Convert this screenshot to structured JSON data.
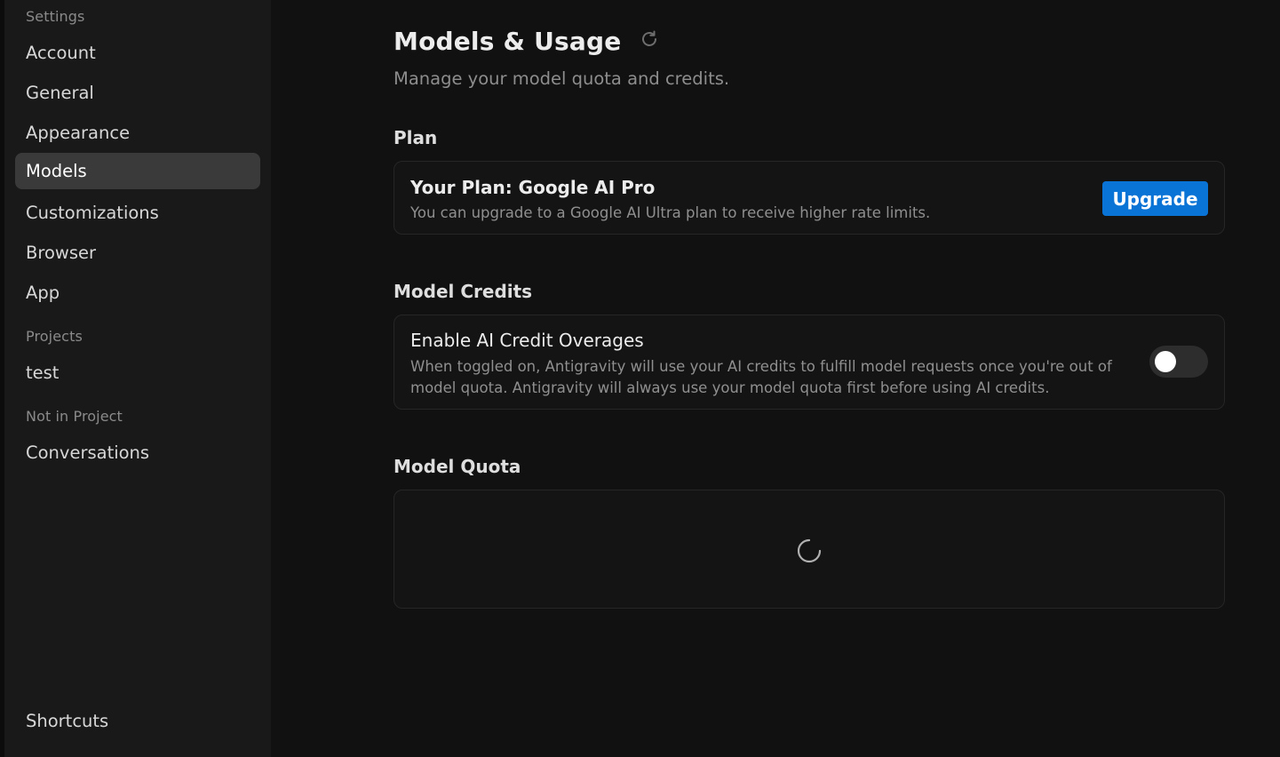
{
  "sidebar": {
    "settings_header": "Settings",
    "items": [
      {
        "label": "Account"
      },
      {
        "label": "General"
      },
      {
        "label": "Appearance"
      },
      {
        "label": "Models"
      },
      {
        "label": "Customizations"
      },
      {
        "label": "Browser"
      },
      {
        "label": "App"
      }
    ],
    "active_item": "Models",
    "projects_header": "Projects",
    "project_items": [
      {
        "label": "test"
      }
    ],
    "not_in_project_header": "Not in Project",
    "not_in_project_items": [
      {
        "label": "Conversations"
      }
    ],
    "footer_item": "Shortcuts"
  },
  "main": {
    "title": "Models & Usage",
    "refresh_icon": "refresh-icon",
    "subtitle": "Manage your model quota and credits.",
    "plan": {
      "section_title": "Plan",
      "card_title": "Your Plan: Google AI Pro",
      "card_desc": "You can upgrade to a Google AI Ultra plan to receive higher rate limits.",
      "upgrade_label": "Upgrade"
    },
    "credits": {
      "section_title": "Model Credits",
      "card_title": "Enable AI Credit Overages",
      "card_desc_line1": "When toggled on, Antigravity will use your AI credits to fulfill model requests once you're out of",
      "card_desc_line2": "model quota. Antigravity will always use your model quota first before using AI credits.",
      "toggle_on": false
    },
    "quota": {
      "section_title": "Model Quota",
      "loading_icon": "loading-spinner-icon"
    }
  },
  "colors": {
    "accent": "#0a74d6",
    "background": "#111111",
    "sidebar": "#191919",
    "active_item": "#3a3a3a"
  }
}
